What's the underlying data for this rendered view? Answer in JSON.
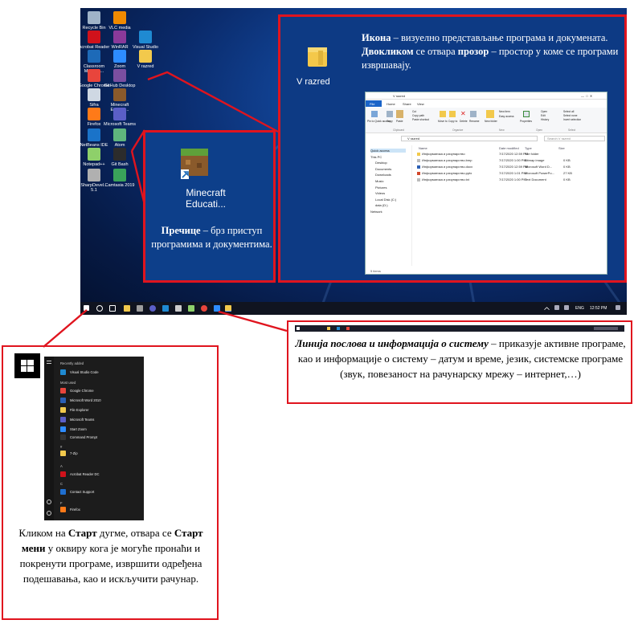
{
  "desktop": {
    "icons": [
      {
        "label": "Recycle Bin",
        "color": "#9fb3c8"
      },
      {
        "label": "VLC media player",
        "color": "#f08a00"
      },
      {
        "label": "Acrobat Reader DC",
        "color": "#d0121b"
      },
      {
        "label": "WinRAR",
        "color": "#8a3a9a"
      },
      {
        "label": "Visual Studio Code",
        "color": "#1f8ad2"
      },
      {
        "label": "Classroom Mode fo...",
        "color": "#1d6ab8"
      },
      {
        "label": "Zoom",
        "color": "#2d8cff"
      },
      {
        "label": "V razred",
        "color": "#f2c94c"
      },
      {
        "label": "Google Chrome",
        "color": "#e8453c"
      },
      {
        "label": "GitHub Desktop",
        "color": "#7b4fa0"
      },
      {
        "label": "Sifra",
        "color": "#cfd8e3"
      },
      {
        "label": "Minecraft Educati...",
        "color": "#8a5a2b"
      },
      {
        "label": "Firefox",
        "color": "#ff7a18"
      },
      {
        "label": "Microsoft Teams",
        "color": "#5b5fc7"
      },
      {
        "label": "NetBeans IDE 8.2",
        "color": "#1a73c9"
      },
      {
        "label": "Atom",
        "color": "#5fb57d"
      },
      {
        "label": "Notepad++",
        "color": "#8ed06a"
      },
      {
        "label": "Git Bash",
        "color": "#2c2c2c"
      },
      {
        "label": "SharpDevel... 5.1",
        "color": "#b0b0b0"
      },
      {
        "label": "Camtasia 2019",
        "color": "#3aa35a"
      }
    ]
  },
  "taskbar": {
    "lang": "ENG",
    "time": "12:52 PM"
  },
  "folder_box": {
    "folder_label": "V razred",
    "text_icon_bold": "Икона",
    "text_icon_rest": " – визуелно представљање програма и докумената.",
    "text_dbl_bold": "Двокликом",
    "text_dbl_mid": " се отвара ",
    "text_window_bold": "прозор",
    "text_window_rest": " – простор у коме се програми извршавају."
  },
  "explorer": {
    "title": "V razred",
    "tabs": [
      "File",
      "Home",
      "Share",
      "View"
    ],
    "ribbon": [
      "Pin to Quick access",
      "Copy",
      "Paste",
      "Cut",
      "Copy path",
      "Paste shortcut",
      "Move to",
      "Copy to",
      "Delete",
      "Rename",
      "New folder",
      "New item",
      "Easy access",
      "Properties",
      "Open",
      "Edit",
      "History",
      "Select all",
      "Select none",
      "Invert selection"
    ],
    "groups": [
      "Clipboard",
      "Organize",
      "New",
      "Open",
      "Select"
    ],
    "address": "V razred",
    "search": "Search V razred",
    "columns": [
      "Name",
      "Date modified",
      "Type",
      "Size"
    ],
    "files": [
      {
        "name": "Информатика и рачунарство",
        "date": "7/17/2020 12:59 PM",
        "type": "File folder",
        "size": ""
      },
      {
        "name": "Информатика и рачунарство.bmp",
        "date": "7/17/2020 1:00 PM",
        "type": "Bitmap image",
        "size": "0 KB"
      },
      {
        "name": "Информатика и рачунарство.docx",
        "date": "7/17/2020 12:59 PM",
        "type": "Microsoft Word D...",
        "size": "0 KB"
      },
      {
        "name": "Информатика и рачунарство.pptx",
        "date": "7/17/2020 1:01 PM",
        "type": "Microsoft PowerPo...",
        "size": "27 KB"
      },
      {
        "name": "Информатика и рачунарство.txt",
        "date": "7/17/2020 1:00 PM",
        "type": "Text Document",
        "size": "0 KB"
      }
    ],
    "nav": [
      "Quick access",
      "This PC",
      "Desktop",
      "Documents",
      "Downloads",
      "Music",
      "Pictures",
      "Videos",
      "Local Disk (C:)",
      "data (D:)",
      "Network"
    ],
    "status": "5 items"
  },
  "shortcut_box": {
    "label": "Minecraft Educati...",
    "bold": "Пречице",
    "rest": " – брз приступ програмима и документима."
  },
  "taskinfo_box": {
    "bold": "Линија послова и информација о систему",
    "rest": " – приказује активне програме, као и информације о систему – датум и време, језик, системске програме (звук,  повезаност на рачунарску мрежу – интернет,…)"
  },
  "start_box": {
    "t1": "Кликом на ",
    "b1": "Старт",
    "t2": " дугме, отвара се ",
    "b2": "Старт мени",
    "t3": " у оквиру кога је могуће пронаћи и покренути програме, извршити одређена подешавања, као и искључити рачунар.",
    "menu": {
      "recently": "Recently added",
      "most": "Most used",
      "items": [
        {
          "label": "Visual Studio Code",
          "color": "#1f8ad2"
        },
        {
          "label": "Google Chrome",
          "color": "#e8453c"
        },
        {
          "label": "Microsoft Word 2010",
          "color": "#2b5fb4"
        },
        {
          "label": "File Explorer",
          "color": "#f2c94c"
        },
        {
          "label": "Microsoft Teams",
          "color": "#5b5fc7"
        },
        {
          "label": "Start Zoom",
          "color": "#2d8cff"
        },
        {
          "label": "Command Prompt",
          "color": "#333333"
        },
        {
          "label": "7-Zip",
          "color": "#f2c94c"
        },
        {
          "label": "Acrobat Reader DC",
          "color": "#d0121b"
        },
        {
          "label": "Contact Support",
          "color": "#1f6fd0"
        },
        {
          "label": "Firefox",
          "color": "#ff7a18"
        }
      ],
      "letters": [
        "#",
        "A",
        "C",
        "F"
      ]
    }
  }
}
